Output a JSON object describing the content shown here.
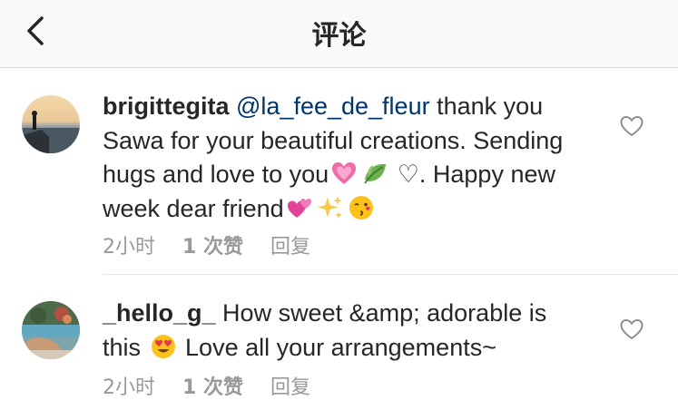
{
  "header": {
    "title": "评论",
    "back_icon": "chevron-left-icon"
  },
  "comments": [
    {
      "username": "brigittegita",
      "mention": "@la_fee_de_fleur",
      "text_1": " thank you Sawa for your beautiful creations. Sending hugs and love to you",
      "text_2": " ♡. Happy new week dear friend",
      "emojis": [
        "sparkling-heart",
        "leaf",
        "two-hearts",
        "sparkles",
        "kissing-face"
      ],
      "time": "2小时",
      "likes": "1 次赞",
      "reply": "回复"
    },
    {
      "username": "_hello_g_",
      "text_1": " How sweet &amp; adorable is this ",
      "text_2": " Love all your arrangements~",
      "emojis": [
        "heart-eyes-face"
      ],
      "time": "2小时",
      "likes": "1 次赞",
      "reply": "回复"
    }
  ],
  "colors": {
    "mention": "#003569",
    "meta": "#999999",
    "text": "#262626",
    "header_bg": "#f9f9f9"
  }
}
